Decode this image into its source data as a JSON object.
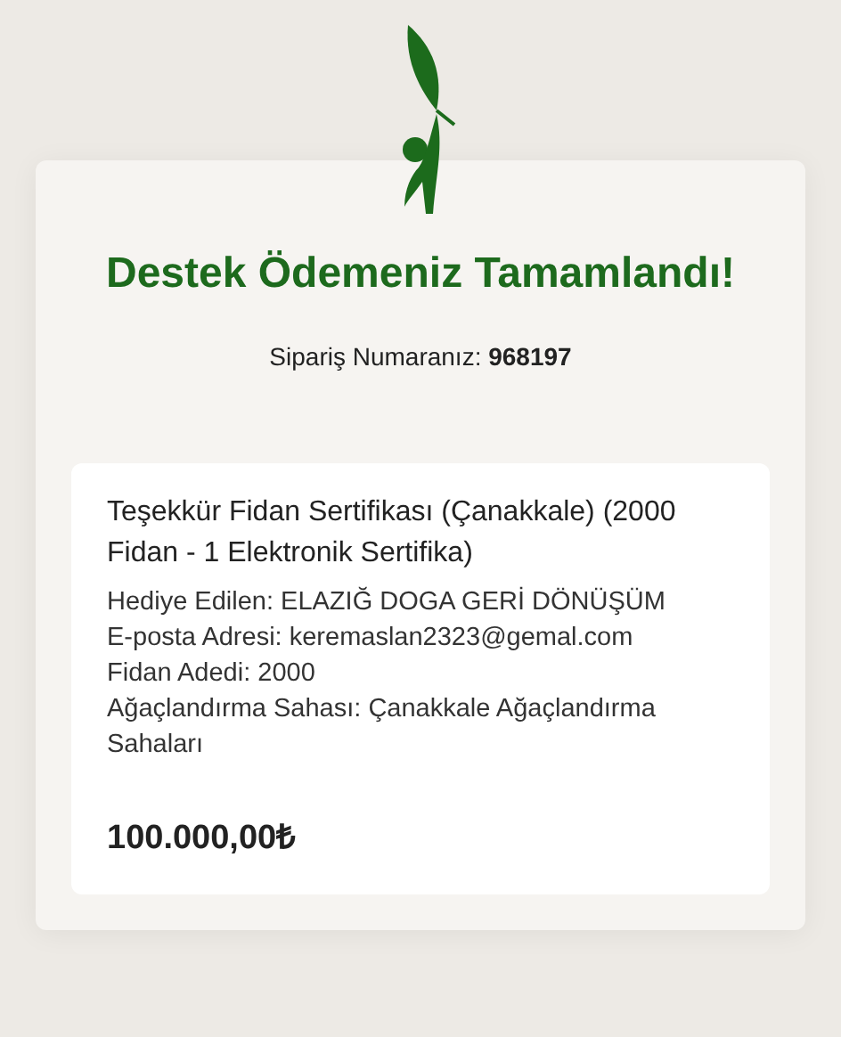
{
  "title": "Destek Ödemeniz Tamamlandı!",
  "order_number": "Sipariş Numaranız: **968197**",
  "item": {
    "name": "Teşekkür Fidan Sertifikası (Çanakkale) (2000 Fidan - 1 Elektronik Sertifika)",
    "details": [
      "Hediye Edilen: ELAZIĞ DOGA GERİ DÖNÜŞÜM",
      "E-posta Adresi: keremaslan2323@gemal.com",
      "Fidan Adedi: 2000",
      "Ağaçlandırma Sahası: Çanakkale Ağaçlandırma Sahaları"
    ],
    "price": "100.000,00₺"
  }
}
